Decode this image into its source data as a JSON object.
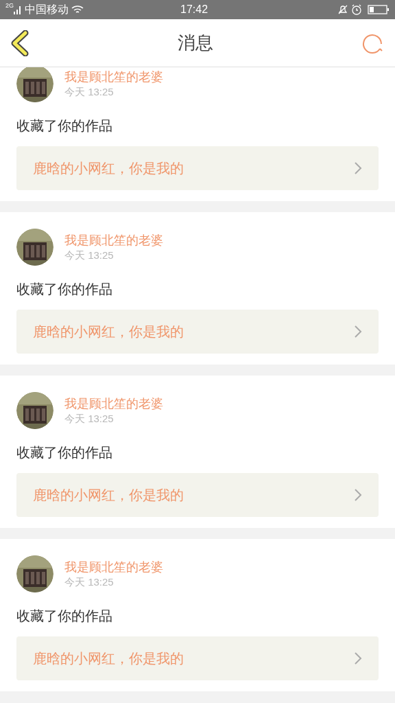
{
  "status_bar": {
    "network": "2G",
    "carrier": "中国移动",
    "time": "17:42"
  },
  "header": {
    "title": "消息"
  },
  "messages": [
    {
      "user": "我是顾北笙的老婆",
      "time": "今天 13:25",
      "action": "收藏了你的作品",
      "work": "鹿晗的小网红，你是我的"
    },
    {
      "user": "我是顾北笙的老婆",
      "time": "今天 13:25",
      "action": "收藏了你的作品",
      "work": "鹿晗的小网红，你是我的"
    },
    {
      "user": "我是顾北笙的老婆",
      "time": "今天 13:25",
      "action": "收藏了你的作品",
      "work": "鹿晗的小网红，你是我的"
    },
    {
      "user": "我是顾北笙的老婆",
      "time": "今天 13:25",
      "action": "收藏了你的作品",
      "work": "鹿晗的小网红，你是我的"
    }
  ]
}
